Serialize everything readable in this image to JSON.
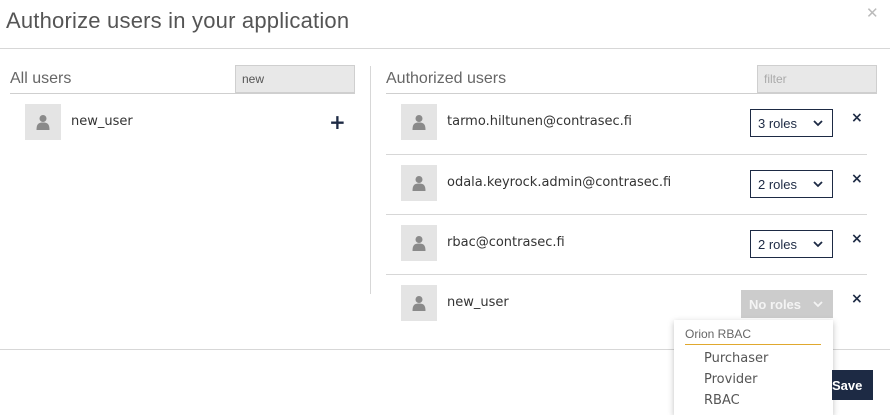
{
  "modal": {
    "title": "Authorize users in your application",
    "close_icon": "close-icon"
  },
  "all_users": {
    "title": "All users",
    "search_value": "new",
    "items": [
      {
        "name": "new_user",
        "add_label": "+"
      }
    ]
  },
  "authorized_users": {
    "title": "Authorized users",
    "filter_placeholder": "filter",
    "items": [
      {
        "name": "tarmo.hiltunen@contrasec.fi",
        "roles_label": "3 roles",
        "remove_label": "×"
      },
      {
        "name": "odala.keyrock.admin@contrasec.fi",
        "roles_label": "2 roles",
        "remove_label": "×"
      },
      {
        "name": "rbac@contrasec.fi",
        "roles_label": "2 roles",
        "remove_label": "×"
      },
      {
        "name": "new_user",
        "roles_label": "No roles",
        "remove_label": "×"
      }
    ]
  },
  "roles_dropdown": {
    "group": "Orion RBAC",
    "options": [
      "Purchaser",
      "Provider",
      "RBAC"
    ]
  },
  "footer": {
    "save_label": "Save"
  },
  "colors": {
    "accent": "#1d2a44",
    "group_underline": "#e0a82e",
    "disabled": "#cccccc"
  }
}
